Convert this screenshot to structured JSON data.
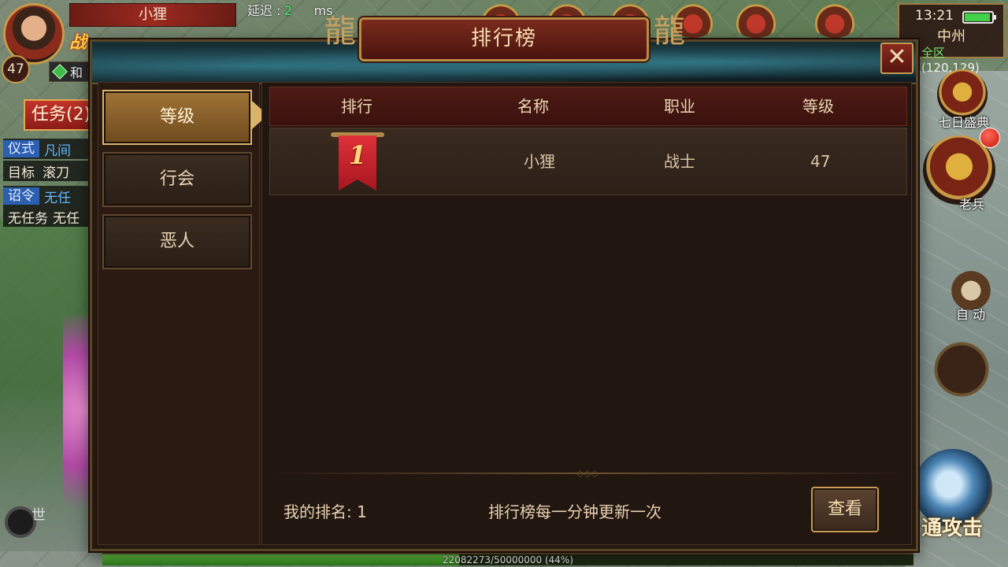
{
  "hud": {
    "player_name": "小狸",
    "player_level": "47",
    "ping_label": "延迟 :",
    "ping_value": "2",
    "ping_unit": "ms",
    "gem_chip_text": "和",
    "quest_button": "任务(2)",
    "quests": [
      {
        "tag": "仪式",
        "value": "凡间"
      },
      {
        "tag": "目标",
        "value": "滚刀"
      },
      {
        "tag": "诏令",
        "value": "无任"
      },
      {
        "tag": "无任务",
        "value": "无任"
      }
    ],
    "voice_channel": "世",
    "clock": "13:21",
    "battery_level": 0.95,
    "map_name": "中州",
    "zone_label": "全区",
    "coords": "(120,129)",
    "seven_day_label": "七日盛典",
    "veteran_label": "老兵",
    "auto_label": "自 动",
    "attack_label": "通攻击",
    "exp_text": "22082273/50000000 (44%)",
    "exp_fraction": 0.44
  },
  "leaderboard": {
    "title": "排行榜",
    "tabs": [
      "等级",
      "行会",
      "恶人"
    ],
    "active_tab": 0,
    "columns": [
      "排行",
      "名称",
      "职业",
      "等级"
    ],
    "rows": [
      {
        "rank": "1",
        "name": "小狸",
        "class": "战士",
        "level": "47"
      }
    ],
    "my_rank_label": "我的排名: 1",
    "update_note": "排行榜每一分钟更新一次",
    "view_button": "查看"
  },
  "colors": {
    "accent_gold": "#c99a46",
    "header_red": "#4e1a14",
    "rank_red": "#c4141e",
    "exp_green": "#6ad044"
  }
}
